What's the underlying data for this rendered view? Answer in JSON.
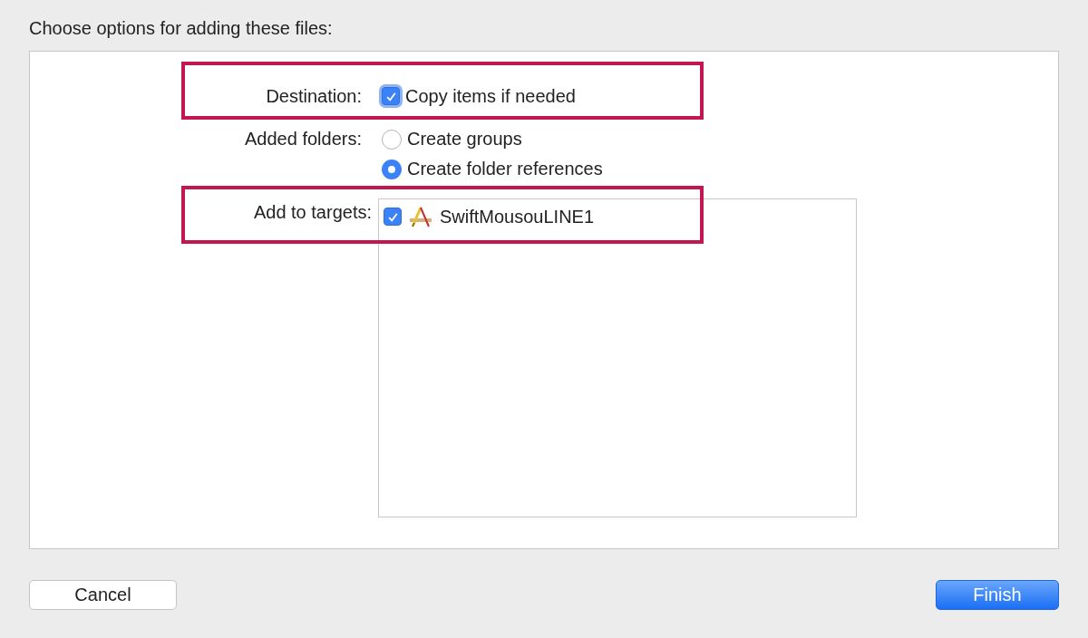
{
  "heading": "Choose options for adding these files:",
  "destination": {
    "label": "Destination:",
    "option": {
      "label": "Copy items if needed",
      "checked": true
    }
  },
  "added_folders": {
    "label": "Added folders:",
    "options": [
      {
        "label": "Create groups",
        "selected": false
      },
      {
        "label": "Create folder references",
        "selected": true
      }
    ]
  },
  "targets": {
    "label": "Add to targets:",
    "items": [
      {
        "name": "SwiftMousouLINE1",
        "checked": true
      }
    ]
  },
  "buttons": [
    {
      "label": "Cancel",
      "kind": "secondary"
    },
    {
      "label": "Finish",
      "kind": "primary"
    }
  ]
}
